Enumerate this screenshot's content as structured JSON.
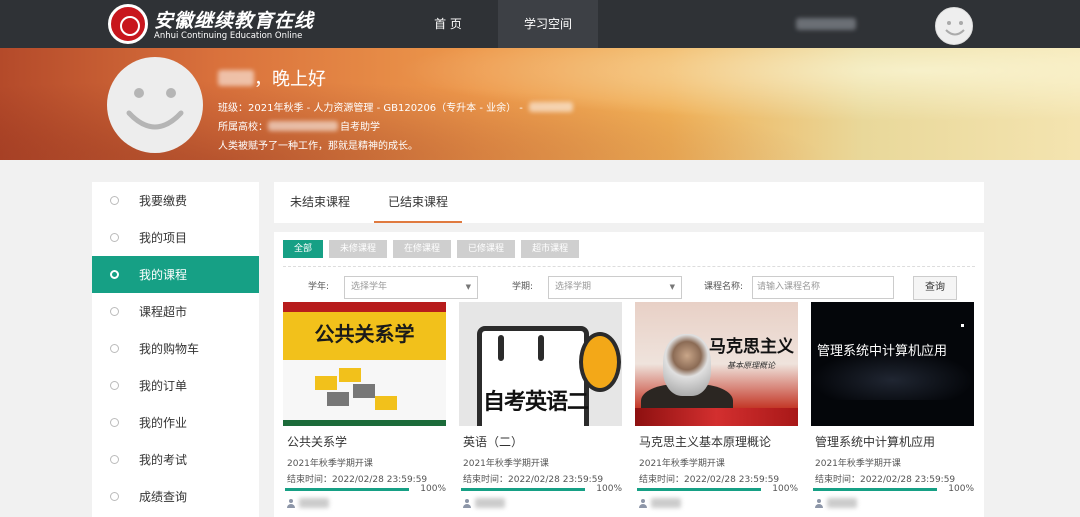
{
  "header": {
    "logo_cn": "安徽继续教育在线",
    "logo_en": "Anhui Continuing Education Online",
    "nav": [
      "首 页",
      "学习空间"
    ]
  },
  "banner": {
    "greeting": "，晚上好",
    "class_label": "班级：2021年秋季 - 人力资源管理 - GB120206（专升本 - 业余） -",
    "school_label": "所属高校：",
    "school_suffix": "自考助学",
    "motto": "人类被赋予了一种工作，那就是精神的成长。"
  },
  "sidebar": {
    "items": [
      "我要缴费",
      "我的项目",
      "我的课程",
      "课程超市",
      "我的购物车",
      "我的订单",
      "我的作业",
      "我的考试",
      "成绩查询"
    ],
    "active_index": 2
  },
  "tabs": [
    "未结束课程",
    "已结束课程"
  ],
  "filters": [
    "全部",
    "未修课程",
    "在修课程",
    "已修课程",
    "超市课程"
  ],
  "search": {
    "year_label": "学年:",
    "year_placeholder": "选择学年",
    "term_label": "学期:",
    "term_placeholder": "选择学期",
    "name_label": "课程名称:",
    "name_placeholder": "请输入课程名称",
    "query_button": "查询"
  },
  "courses": [
    {
      "title": "公共关系学",
      "term": "2021年秋季学期开课",
      "end": "结束时间：2022/02/28 23:59:59",
      "progress": "100%",
      "progress_value": 1.0,
      "cover_title": "公共关系学"
    },
    {
      "title": "英语（二）",
      "term": "2021年秋季学期开课",
      "end": "结束时间：2022/02/28 23:59:59",
      "progress": "100%",
      "progress_value": 1.0,
      "cover_title": "自考英语二"
    },
    {
      "title": "马克思主义基本原理概论",
      "term": "2021年秋季学期开课",
      "end": "结束时间：2022/02/28 23:59:59",
      "progress": "100%",
      "progress_value": 1.0,
      "cover_title": "马克思主义",
      "cover_subtitle": "基本原理概论"
    },
    {
      "title": "管理系统中计算机应用",
      "term": "2021年秋季学期开课",
      "end": "结束时间：2022/02/28 23:59:59",
      "progress": "100%",
      "progress_value": 1.0,
      "cover_title": "管理系统中计算机应用"
    }
  ],
  "colors": {
    "accent": "#16a085",
    "header_bg": "#2f3236",
    "tab_underline": "#e07a3f"
  }
}
